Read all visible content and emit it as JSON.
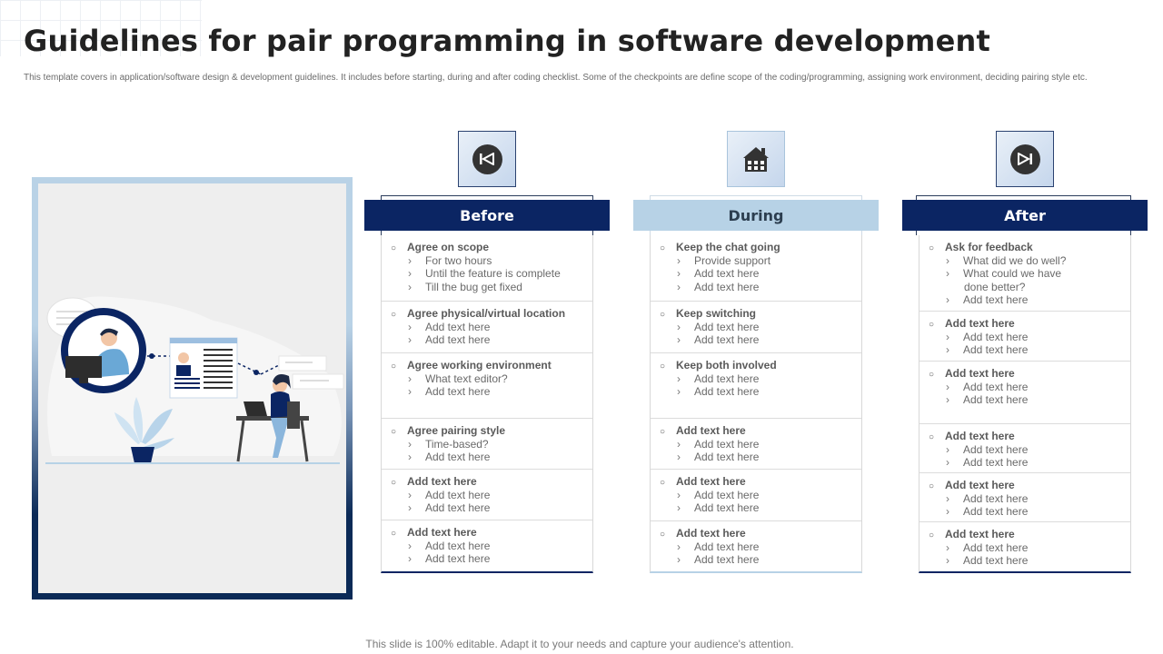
{
  "title": "Guidelines for pair programming in software development",
  "subtitle": "This template covers in application/software design & development guidelines.  It includes before starting, during and after coding checklist. Some of the checkpoints are define scope of the coding/programming, assigning work environment, deciding pairing style etc.",
  "footer": "This slide is 100% editable. Adapt it to your needs and capture your audience's attention.",
  "colors": {
    "navy": "#0b2563",
    "light_blue": "#b7d2e6"
  },
  "columns": [
    {
      "header": "Before",
      "icon": "skip-back-icon",
      "sections": [
        {
          "head": "Agree on scope",
          "items": [
            "For two hours",
            "Until the feature is complete",
            "Till the bug get fixed"
          ]
        },
        {
          "head": "Agree physical/virtual  location",
          "items": [
            "Add text here",
            "Add text here"
          ]
        },
        {
          "head": "Agree working environment",
          "items": [
            "What text editor?",
            "Add text here"
          ]
        },
        {
          "head": "Agree pairing style",
          "items": [
            "Time-based?",
            "Add text here"
          ]
        },
        {
          "head": "Add text here",
          "items": [
            "Add text here",
            "Add text here"
          ]
        },
        {
          "head": "Add text here",
          "items": [
            "Add text here",
            "Add text here"
          ]
        }
      ]
    },
    {
      "header": "During",
      "icon": "house-icon",
      "sections": [
        {
          "head": "Keep the chat going",
          "items": [
            "Provide support",
            "Add text here",
            "Add text here"
          ]
        },
        {
          "head": "Keep switching",
          "items": [
            "Add text here",
            "Add text here"
          ]
        },
        {
          "head": "Keep both involved",
          "items": [
            "Add text here",
            "Add text here"
          ]
        },
        {
          "head": "Add text here",
          "items": [
            "Add text here",
            "Add text here"
          ]
        },
        {
          "head": "Add text here",
          "items": [
            "Add text here",
            "Add text here"
          ]
        },
        {
          "head": "Add text here",
          "items": [
            "Add text here",
            "Add text here"
          ]
        }
      ]
    },
    {
      "header": "After",
      "icon": "skip-forward-icon",
      "sections": [
        {
          "head": "Ask for feedback",
          "items": [
            "What did we do well?",
            "What could we have",
            "done better?",
            "Add text here"
          ]
        },
        {
          "head": "Add text here",
          "items": [
            "Add text here",
            "Add text here"
          ]
        },
        {
          "head": "Add text here",
          "items": [
            "Add text here",
            "Add text here"
          ]
        },
        {
          "head": "Add text here",
          "items": [
            "Add text here",
            "Add text here"
          ]
        },
        {
          "head": "Add text here",
          "items": [
            "Add text here",
            "Add text here"
          ]
        },
        {
          "head": "Add text here",
          "items": [
            "Add text here",
            "Add text here"
          ]
        }
      ]
    }
  ]
}
